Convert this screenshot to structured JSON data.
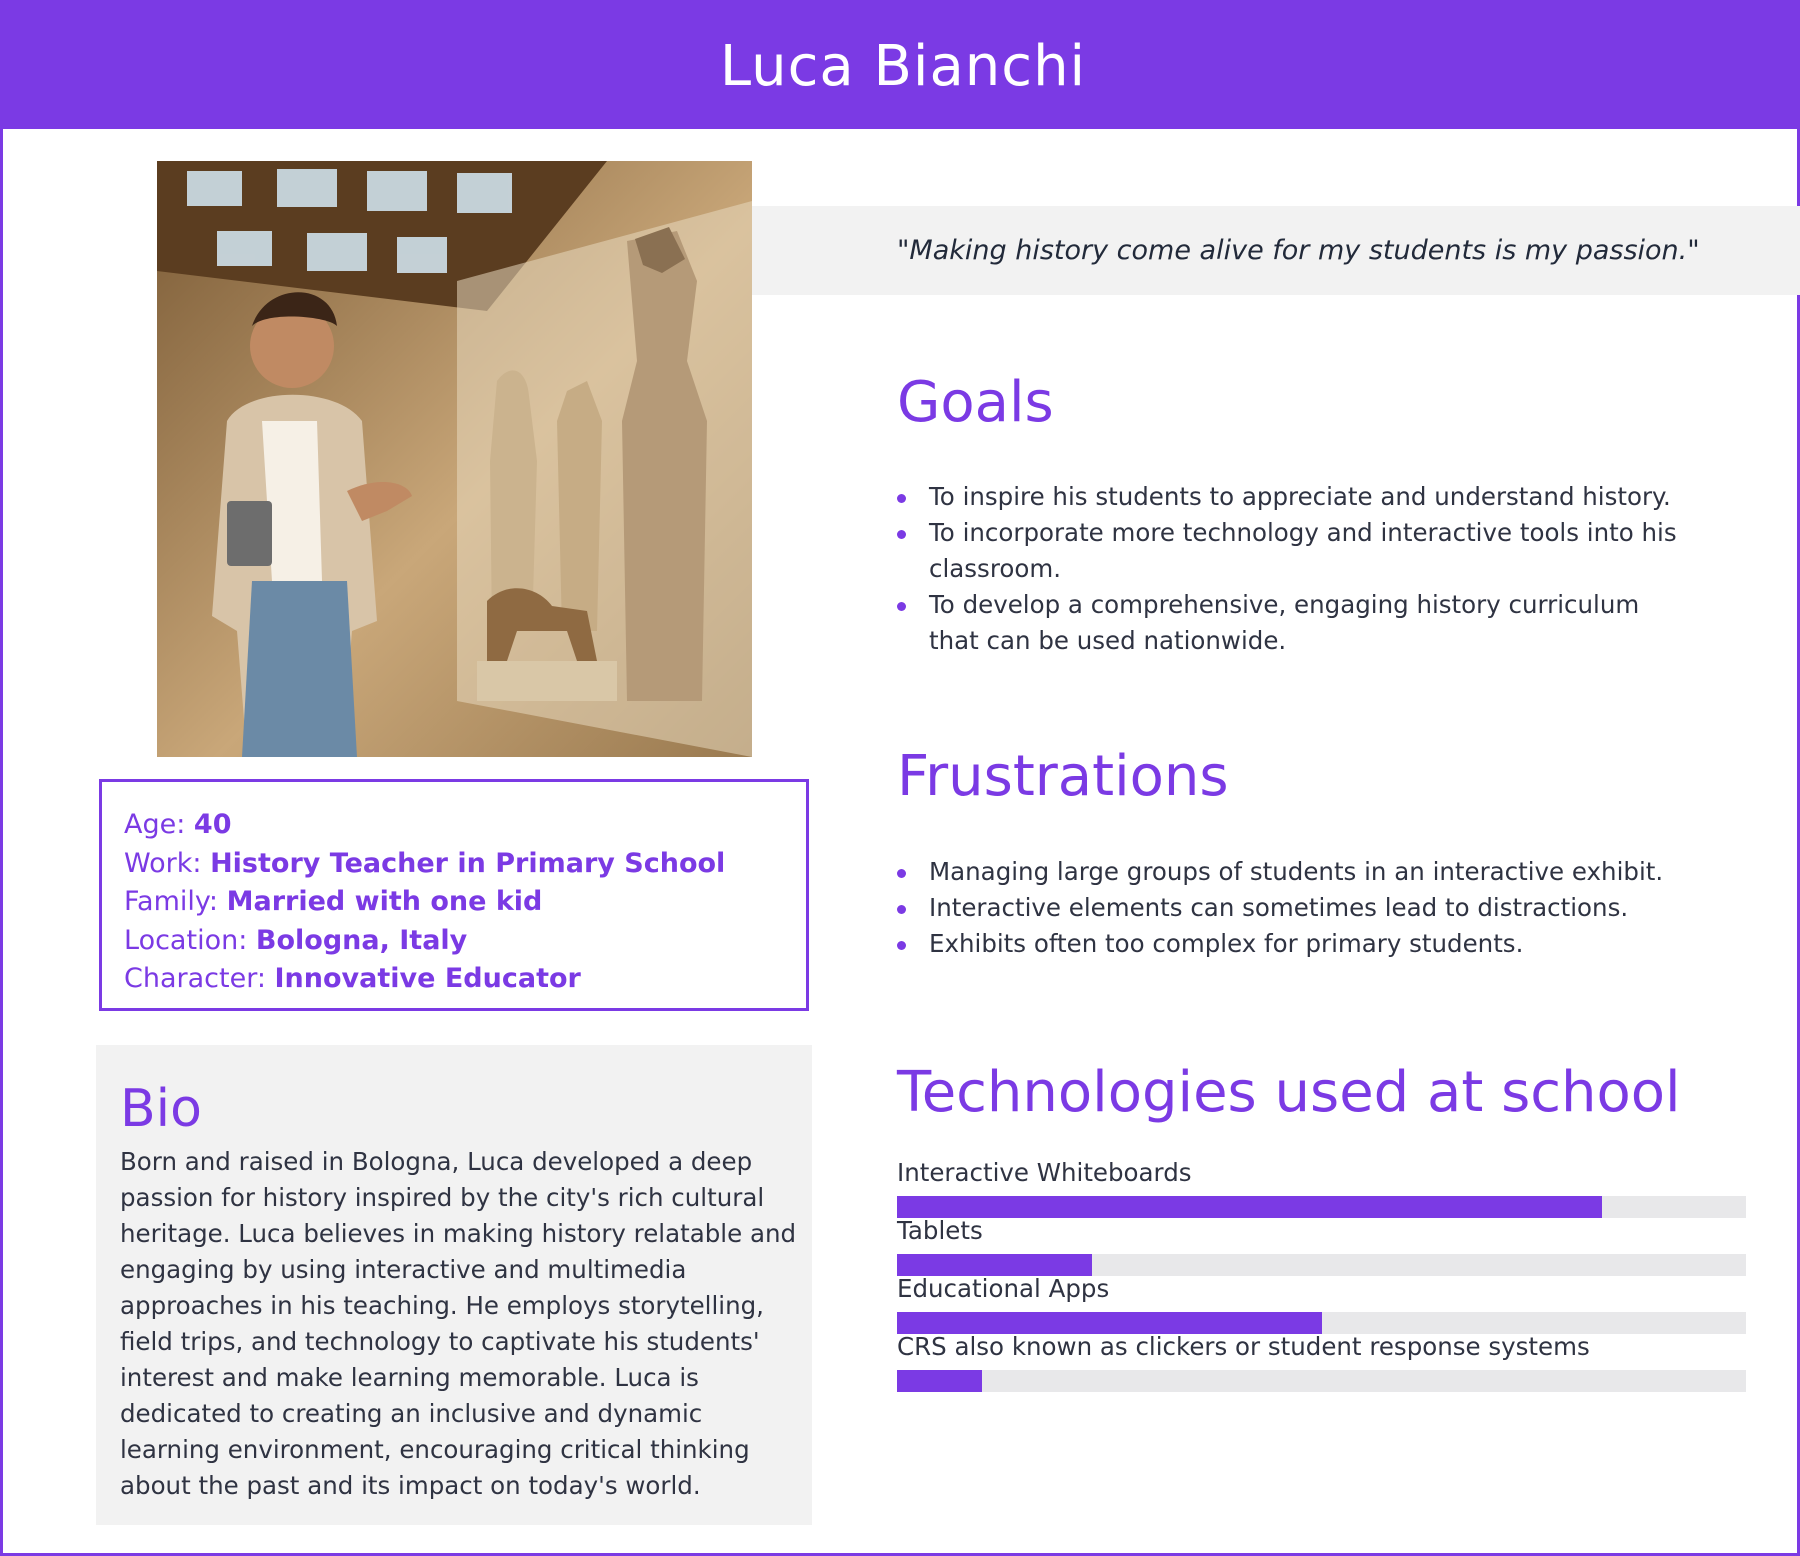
{
  "header": {
    "title": "Luca Bianchi"
  },
  "quote": "\"Making history come alive for my students is my passion.\"",
  "goals": {
    "title": "Goals",
    "items": [
      "To inspire his students to appreciate and understand history.",
      "To incorporate more technology and interactive tools into his classroom.",
      "To develop a comprehensive, engaging history curriculum that can be used nationwide."
    ]
  },
  "frustrations": {
    "title": "Frustrations",
    "items": [
      "Managing large groups of students in an interactive exhibit.",
      "Interactive elements can sometimes lead to distractions.",
      "Exhibits often too complex for primary students."
    ]
  },
  "info": {
    "age_label": "Age:",
    "age_value": "40",
    "work_label": "Work:",
    "work_value": "History Teacher in Primary School",
    "family_label": "Family:",
    "family_value": "Married with one kid",
    "location_label": "Location:",
    "location_value": "Bologna, Italy",
    "character_label": "Character:",
    "character_value": "Innovative Educator"
  },
  "bio": {
    "title": "Bio",
    "text": "Born and raised in Bologna, Luca developed a deep passion for history inspired by the city's rich cultural heritage. Luca believes in making history relatable and engaging by using interactive and multimedia approaches in his teaching. He employs storytelling, field trips, and technology to captivate his students' interest and make learning memorable. Luca is dedicated to creating an inclusive and dynamic learning environment, encouraging critical thinking about the past and its impact on today's world."
  },
  "technologies": {
    "title": "Technologies used at school",
    "items": [
      {
        "label": "Interactive Whiteboards",
        "level": 0.83
      },
      {
        "label": "Tablets",
        "level": 0.23
      },
      {
        "label": "Educational Apps",
        "level": 0.5
      },
      {
        "label": "CRS also known as clickers or student response systems",
        "level": 0.1
      }
    ]
  },
  "colors": {
    "accent": "#7b3ae4",
    "panel": "#f2f2f2",
    "bar_track": "#e8e8ea"
  },
  "photo": {
    "alt": "museum-photo"
  }
}
